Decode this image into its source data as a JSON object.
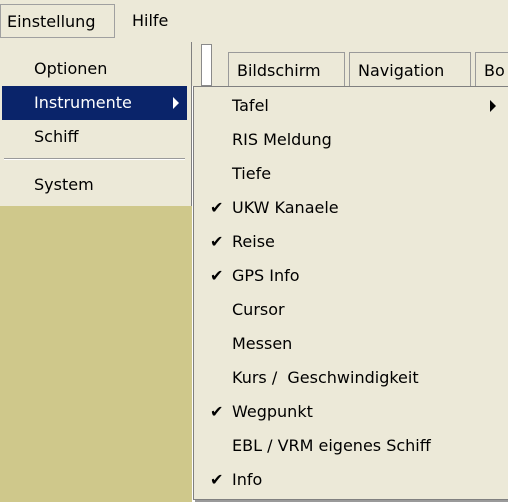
{
  "menubar": {
    "items": [
      {
        "label": "Einstellung"
      },
      {
        "label": "Hilfe"
      }
    ]
  },
  "tabs": [
    {
      "label": "Bildschirm"
    },
    {
      "label": "Navigation"
    },
    {
      "label": "Bo"
    }
  ],
  "submenu_einstellung": {
    "items": [
      {
        "label": "Optionen"
      },
      {
        "label": "Instrumente",
        "selected": true,
        "has_submenu": true
      },
      {
        "label": "Schiff"
      },
      {
        "label": "System"
      }
    ]
  },
  "submenu_instrumente": {
    "items": [
      {
        "label": "Tafel",
        "checked": false,
        "has_submenu": true
      },
      {
        "label": "RIS Meldung",
        "checked": false
      },
      {
        "label": "Tiefe",
        "checked": false
      },
      {
        "label": "UKW Kanaele",
        "checked": true
      },
      {
        "label": "Reise",
        "checked": true
      },
      {
        "label": "GPS Info",
        "checked": true
      },
      {
        "label": "Cursor",
        "checked": false
      },
      {
        "label": "Messen",
        "checked": false
      },
      {
        "label": "Kurs /  Geschwindigkeit",
        "checked": false
      },
      {
        "label": "Wegpunkt",
        "checked": true
      },
      {
        "label": "EBL / VRM eigenes Schiff",
        "checked": false
      },
      {
        "label": "Info",
        "checked": true
      }
    ]
  },
  "colors": {
    "menu_bg": "#ece9d8",
    "selection": "#0a246a",
    "background_panel": "#cfc88b"
  }
}
